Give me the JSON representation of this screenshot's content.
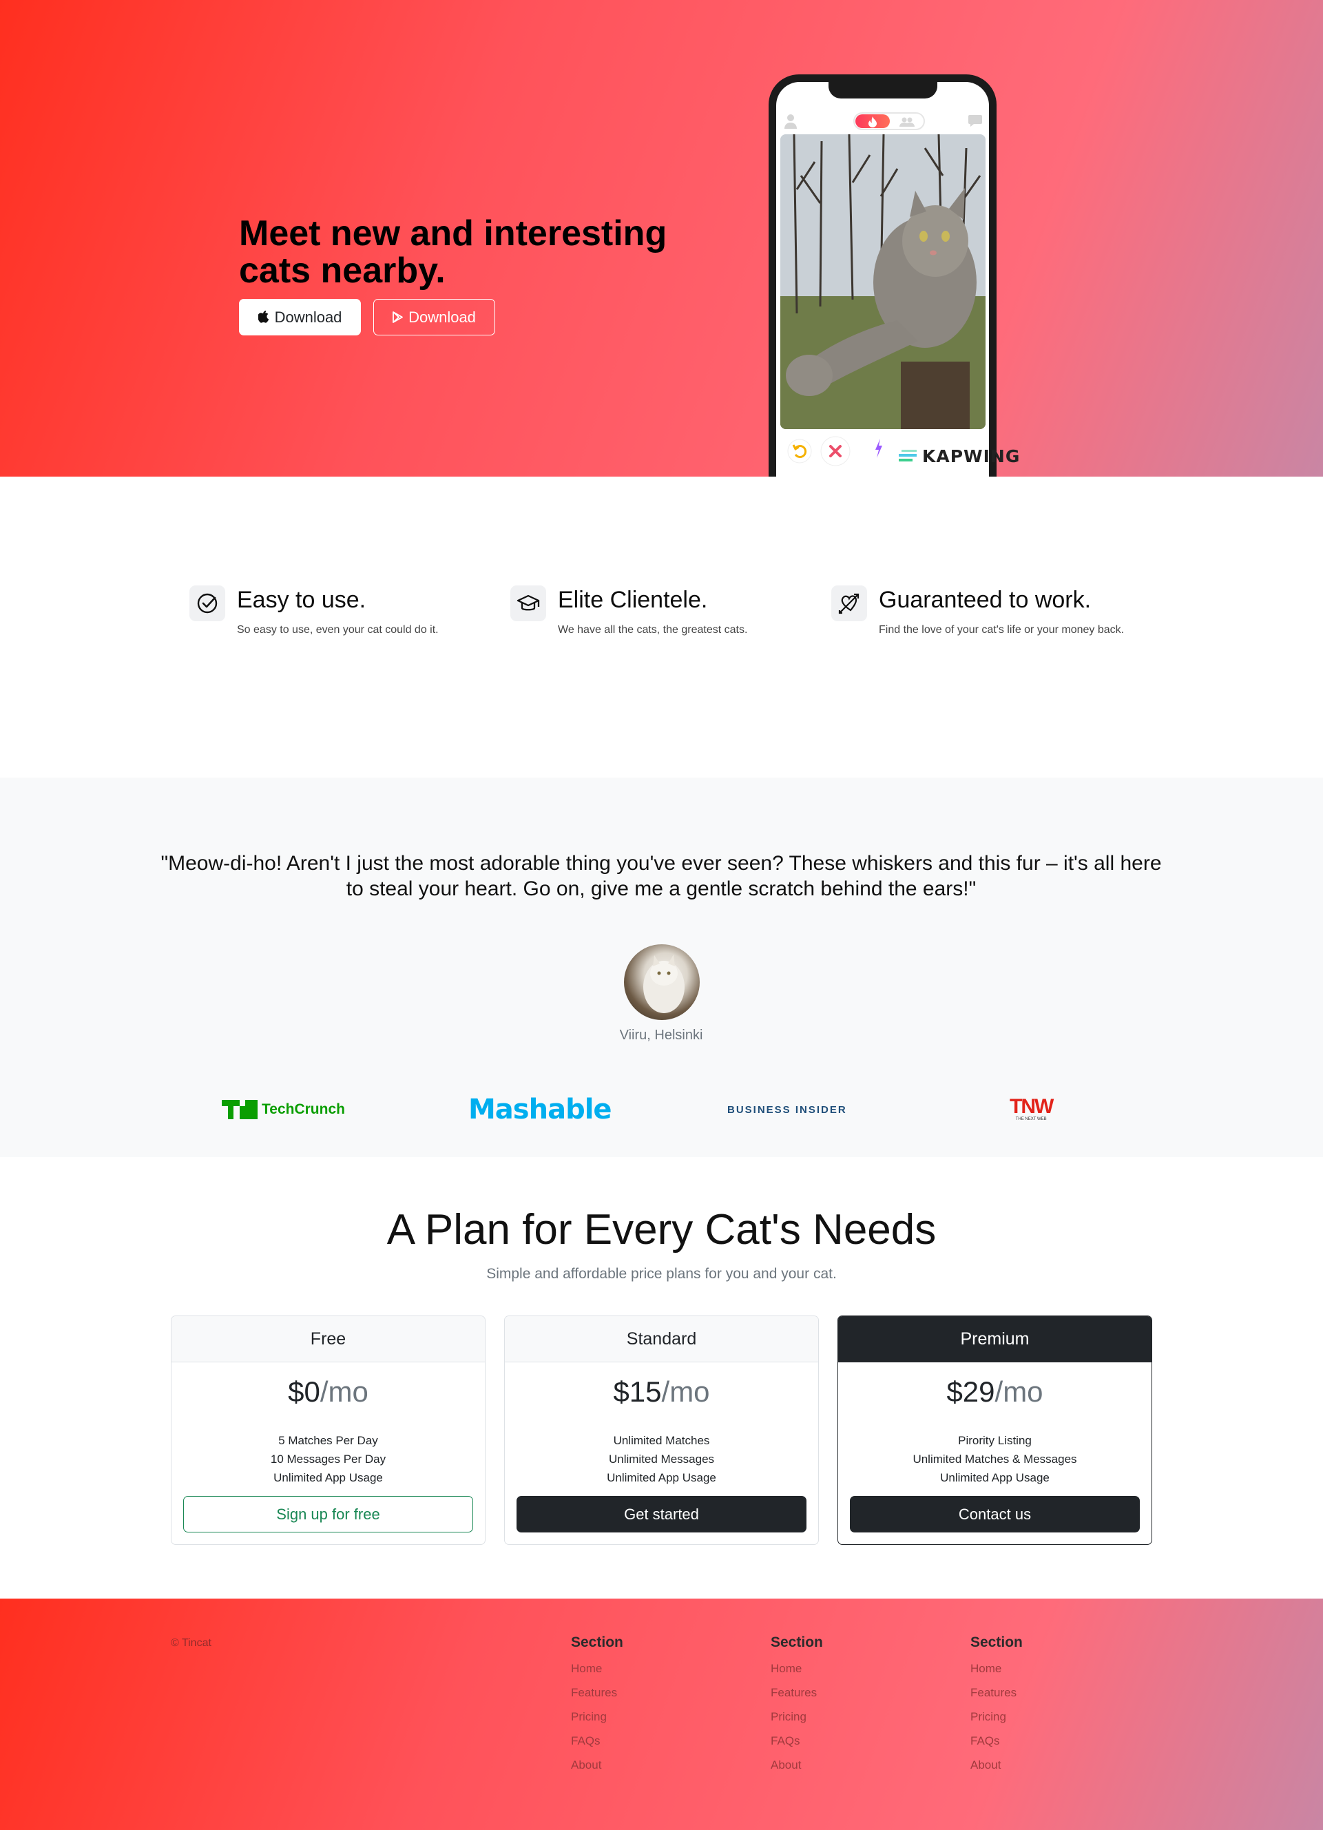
{
  "hero": {
    "title": "Meet new and interesting cats nearby.",
    "apple_button": "Download",
    "play_button": "Download",
    "phone_watermark": "KAPWING"
  },
  "features": [
    {
      "icon": "check-circle-icon",
      "title": "Easy to use.",
      "desc": "So easy to use, even your cat could do it."
    },
    {
      "icon": "graduation-cap-icon",
      "title": "Elite Clientele.",
      "desc": "We have all the cats, the greatest cats."
    },
    {
      "icon": "heart-arrow-icon",
      "title": "Guaranteed to work.",
      "desc": "Find the love of your cat's life or your money back."
    }
  ],
  "testimonial": {
    "quote": "\"Meow-di-ho! Aren't I just the most adorable thing you've ever seen? These whiskers and this fur – it's all here to steal your heart. Go on, give me a gentle scratch behind the ears!\"",
    "author": "Viiru, Helsinki"
  },
  "press": [
    {
      "name": "techcrunch-logo",
      "text": "TechCrunch",
      "color": "#0a9e01"
    },
    {
      "name": "mashable-logo",
      "text": "Mashable",
      "color": "#00aeef"
    },
    {
      "name": "business-insider-logo",
      "text": "BUSINESS INSIDER",
      "color": "#1f4e79"
    },
    {
      "name": "tnw-logo",
      "text": "TNW",
      "sub": "THE NEXT WEB",
      "color": "#e2231a"
    }
  ],
  "pricing": {
    "title": "A Plan for Every Cat's Needs",
    "subtitle": "Simple and affordable price plans for you and your cat.",
    "plans": [
      {
        "name": "Free",
        "price": "$0",
        "per": "/mo",
        "features": [
          "5 Matches Per Day",
          "10 Messages Per Day",
          "Unlimited App Usage"
        ],
        "button": "Sign up for free"
      },
      {
        "name": "Standard",
        "price": "$15",
        "per": "/mo",
        "features": [
          "Unlimited Matches",
          "Unlimited Messages",
          "Unlimited App Usage"
        ],
        "button": "Get started"
      },
      {
        "name": "Premium",
        "price": "$29",
        "per": "/mo",
        "features": [
          "Pirority Listing",
          "Unlimited Matches & Messages",
          "Unlimited App Usage"
        ],
        "button": "Contact us"
      }
    ]
  },
  "footer": {
    "copyright": "© Tincat",
    "columns": [
      {
        "heading": "Section",
        "links": [
          "Home",
          "Features",
          "Pricing",
          "FAQs",
          "About"
        ]
      },
      {
        "heading": "Section",
        "links": [
          "Home",
          "Features",
          "Pricing",
          "FAQs",
          "About"
        ]
      },
      {
        "heading": "Section",
        "links": [
          "Home",
          "Features",
          "Pricing",
          "FAQs",
          "About"
        ]
      }
    ]
  }
}
